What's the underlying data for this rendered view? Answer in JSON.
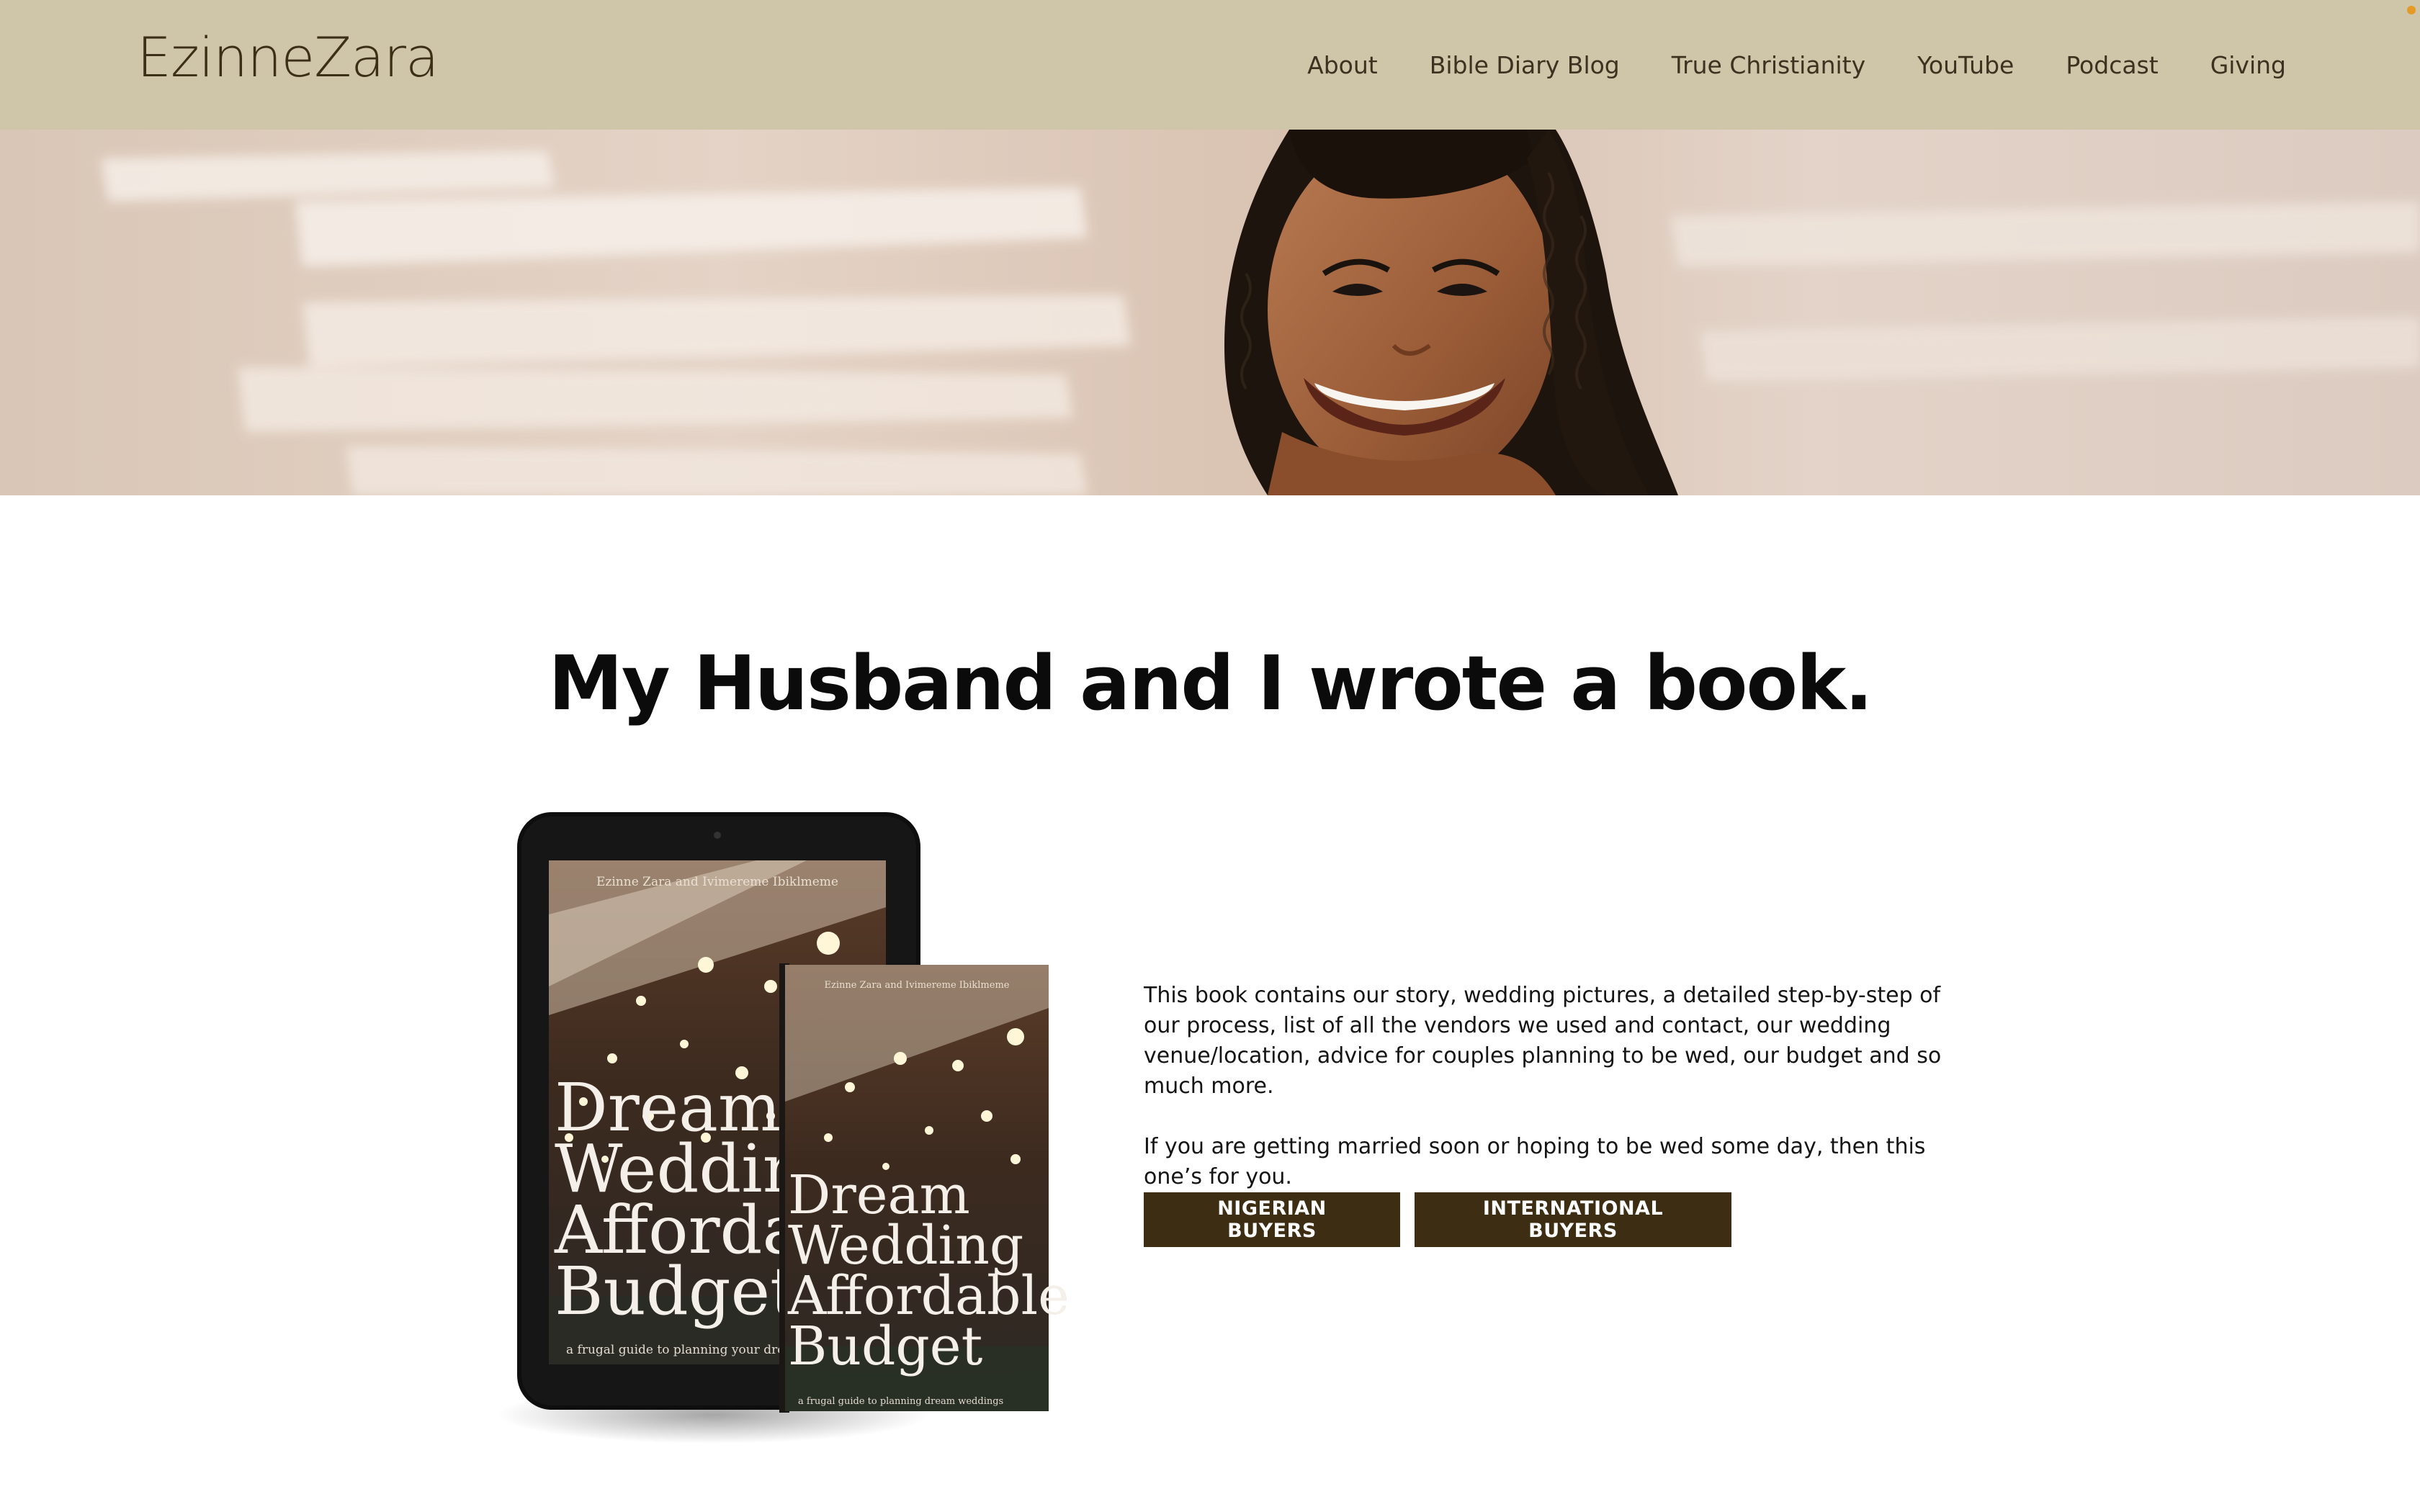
{
  "header": {
    "logo": "EzinneZara",
    "nav": [
      "About",
      "Bible Diary Blog",
      "True Christianity",
      "YouTube",
      "Podcast",
      "Giving"
    ]
  },
  "hero": {
    "image": "smiling woman with braids against sunlit wall"
  },
  "main": {
    "headline": "My Husband and I wrote a book.",
    "paragraphs": [
      "This book contains our story, wedding pictures, a detailed step-by-step of our process, list of all the vendors we used and contact, our wedding venue/location, advice for couples planning to be wed, our budget and so much more.",
      "If you are getting married soon or hoping to be wed some day, then this one’s for you."
    ],
    "buttons": {
      "nigerian": "NIGERIAN BUYERS",
      "international": "INTERNATIONAL BUYERS"
    }
  },
  "book": {
    "authors": "Ezinne Zara and Ivimereme Ibiklmeme",
    "title_lines": [
      "Dream",
      "Wedding",
      "Affordable",
      "Budget"
    ],
    "subtitle": "a frugal guide to planning your dream weddings",
    "subtitle_print": "a frugal guide to planning dream weddings"
  },
  "colors": {
    "header_bg": "#cfc5a9",
    "brand_dark": "#3d2d12",
    "logo": "#3b2f17"
  }
}
